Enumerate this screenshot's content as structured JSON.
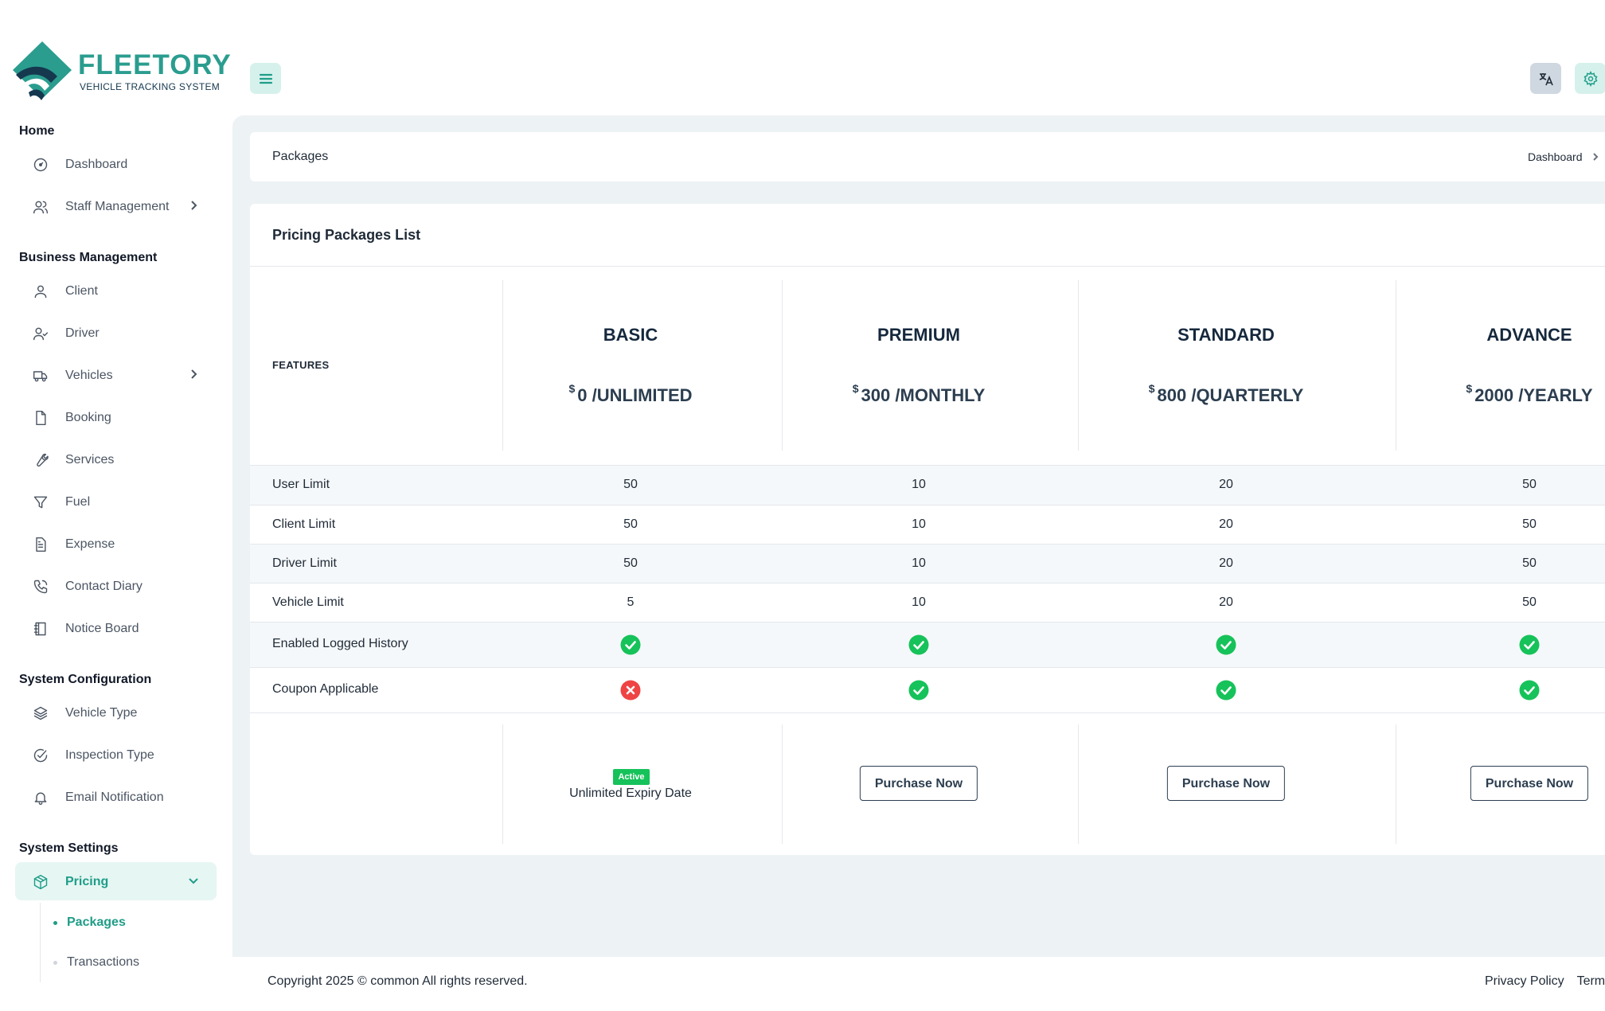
{
  "brand": {
    "name": "FLEETORY",
    "tagline": "VEHICLE TRACKING SYSTEM",
    "primary_color": "#2a9d8f",
    "dark_color": "#15384f"
  },
  "sidebar": {
    "sections": [
      {
        "title": "Home",
        "items": [
          {
            "label": "Dashboard",
            "icon": "dashboard-icon"
          },
          {
            "label": "Staff Management",
            "icon": "users-icon",
            "has_submenu": true
          }
        ]
      },
      {
        "title": "Business Management",
        "items": [
          {
            "label": "Client",
            "icon": "user-icon"
          },
          {
            "label": "Driver",
            "icon": "user-check-icon"
          },
          {
            "label": "Vehicles",
            "icon": "truck-icon",
            "has_submenu": true
          },
          {
            "label": "Booking",
            "icon": "file-icon"
          },
          {
            "label": "Services",
            "icon": "wrench-icon"
          },
          {
            "label": "Fuel",
            "icon": "filter-icon"
          },
          {
            "label": "Expense",
            "icon": "receipt-icon"
          },
          {
            "label": "Contact Diary",
            "icon": "phone-icon"
          },
          {
            "label": "Notice Board",
            "icon": "notebook-icon"
          }
        ]
      },
      {
        "title": "System Configuration",
        "items": [
          {
            "label": "Vehicle Type",
            "icon": "layers-icon"
          },
          {
            "label": "Inspection Type",
            "icon": "check-circle-icon"
          },
          {
            "label": "Email Notification",
            "icon": "bell-icon"
          }
        ]
      },
      {
        "title": "System Settings",
        "items": [
          {
            "label": "Pricing",
            "icon": "package-icon",
            "has_submenu": true,
            "active": true
          }
        ]
      }
    ],
    "pricing_submenu": [
      {
        "label": "Packages",
        "active": true
      },
      {
        "label": "Transactions",
        "active": false
      }
    ]
  },
  "page": {
    "title": "Packages",
    "breadcrumb": "Dashboard"
  },
  "pricing": {
    "card_title": "Pricing Packages List",
    "features_label": "FEATURES",
    "currency_symbol": "$",
    "plans": [
      {
        "name": "BASIC",
        "price": "0",
        "period": "/UNLIMITED"
      },
      {
        "name": "PREMIUM",
        "price": "300",
        "period": "/MONTHLY"
      },
      {
        "name": "STANDARD",
        "price": "800",
        "period": "/QUARTERLY"
      },
      {
        "name": "ADVANCE",
        "price": "2000",
        "period": "/YEARLY"
      }
    ],
    "rows": [
      {
        "label": "User Limit",
        "values": [
          "50",
          "10",
          "20",
          "50"
        ]
      },
      {
        "label": "Client Limit",
        "values": [
          "50",
          "10",
          "20",
          "50"
        ]
      },
      {
        "label": "Driver Limit",
        "values": [
          "50",
          "10",
          "20",
          "50"
        ]
      },
      {
        "label": "Vehicle Limit",
        "values": [
          "5",
          "10",
          "20",
          "50"
        ]
      }
    ],
    "boolean_rows": [
      {
        "label": "Enabled Logged History",
        "values": [
          true,
          true,
          true,
          true
        ]
      },
      {
        "label": "Coupon Applicable",
        "values": [
          false,
          true,
          true,
          true
        ]
      }
    ],
    "active_badge": "Active",
    "active_expiry": "Unlimited Expiry Date",
    "purchase_label": "Purchase Now",
    "colors": {
      "yes": "#16c25a",
      "no": "#ef4444"
    }
  },
  "footer": {
    "copyright": "Copyright 2025 © common All rights reserved.",
    "links": [
      "Privacy Policy",
      "Terms"
    ]
  }
}
